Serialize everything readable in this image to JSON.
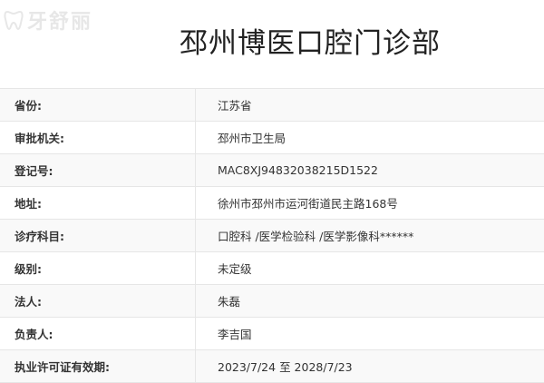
{
  "page": {
    "title": "邳州博医口腔门诊部"
  },
  "watermark": {
    "text": "牙舒丽",
    "icon": "tooth-icon"
  },
  "colors": {
    "row_alt_bg": "#f9f9f9",
    "row_bg": "#ffffff",
    "border": "#e6e6e6",
    "text": "#333333"
  },
  "info": {
    "rows": [
      {
        "label": "省份:",
        "value": "江苏省"
      },
      {
        "label": "审批机关:",
        "value": "邳州市卫生局"
      },
      {
        "label": "登记号:",
        "value": "MAC8XJ94832038215D1522"
      },
      {
        "label": "地址:",
        "value": "徐州市邳州市运河街道民主路168号"
      },
      {
        "label": "诊疗科目:",
        "value": "口腔科 /医学检验科 /医学影像科******"
      },
      {
        "label": "级别:",
        "value": "未定级"
      },
      {
        "label": "法人:",
        "value": "朱磊"
      },
      {
        "label": "负责人:",
        "value": "李吉国"
      },
      {
        "label": "执业许可证有效期:",
        "value": "2023/7/24 至 2028/7/23"
      }
    ]
  }
}
